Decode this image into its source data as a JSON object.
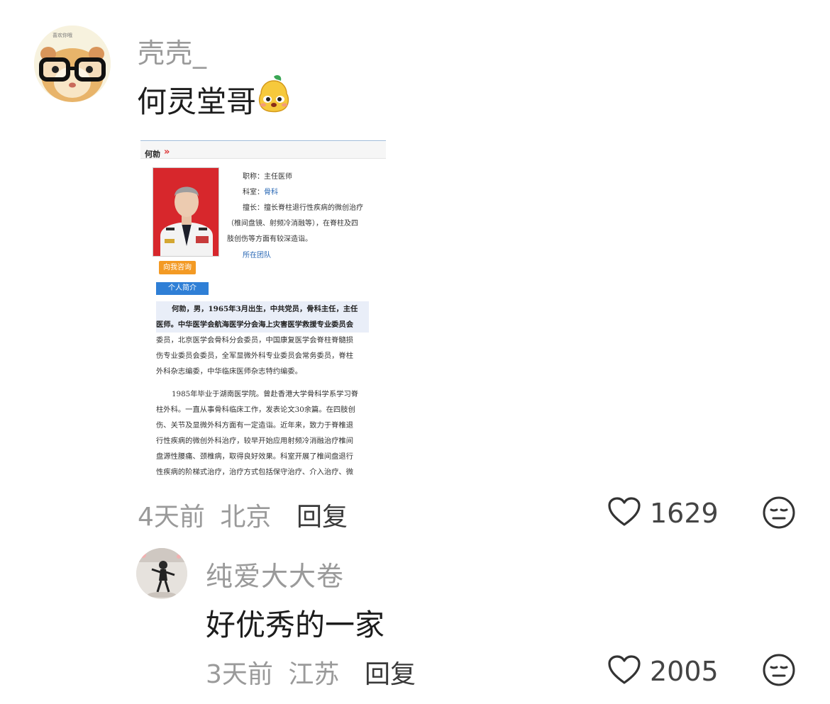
{
  "comments": [
    {
      "username": "壳壳_",
      "text": "何灵堂哥",
      "time": "4天前",
      "location": "北京",
      "reply_label": "回复",
      "likes": "1629",
      "avatar_badge": "喜欢你哦",
      "attached_image": {
        "header_name": "何勍",
        "header_arrow": "»",
        "title_row": "职称：主任医师",
        "dept_label": "科室：",
        "dept_value": "骨科",
        "specialty_1": "擅长：擅长脊柱退行性疾病的微创治疗",
        "specialty_2": "（椎间盘镜、射频冷消融等），在脊柱及四",
        "specialty_3": "肢创伤等方面有较深造诣。",
        "team_link": "所在团队",
        "consult_button": "向我咨询",
        "intro_tab": "个人简介",
        "para1": [
          "何勍，男，1965年3月出生，中共党员，骨科主任，主任",
          "医师。中华医学会航海医学分会海上灾害医学救援专业委员会",
          "委员，北京医学会骨科分会委员，中国康复医学会脊柱脊髓损",
          "伤专业委员会委员，全军显微外科专业委员会常务委员，脊柱",
          "外科杂志编委，中华临床医师杂志特约编委。"
        ],
        "para2": [
          "1985年毕业于湖南医学院。曾赴香港大学骨科学系学习脊",
          "柱外科。一直从事骨科临床工作，发表论文30余篇。在四肢创",
          "伤、关节及显微外科方面有一定造诣。近年来，致力于脊椎退",
          "行性疾病的微创外科治疗，较早开始应用射频冷消融治疗椎间",
          "盘源性腰痛、颈椎病，取得良好效果。科室开展了椎间盘退行",
          "性疾病的阶梯式治疗，治疗方式包括保守治疗、介入治疗、微"
        ]
      }
    },
    {
      "username": "纯爱大大卷",
      "text": "好优秀的一家",
      "time": "3天前",
      "location": "江苏",
      "reply_label": "回复",
      "likes": "2005"
    }
  ],
  "colors": {
    "meta": "#9a9a9a",
    "text": "#1c1c1c",
    "consult": "#f39a24",
    "intro": "#2f7fd6",
    "link": "#2a68b5"
  },
  "icons": [
    "heart-icon",
    "dislike-face-icon",
    "pear-emoji-icon"
  ]
}
